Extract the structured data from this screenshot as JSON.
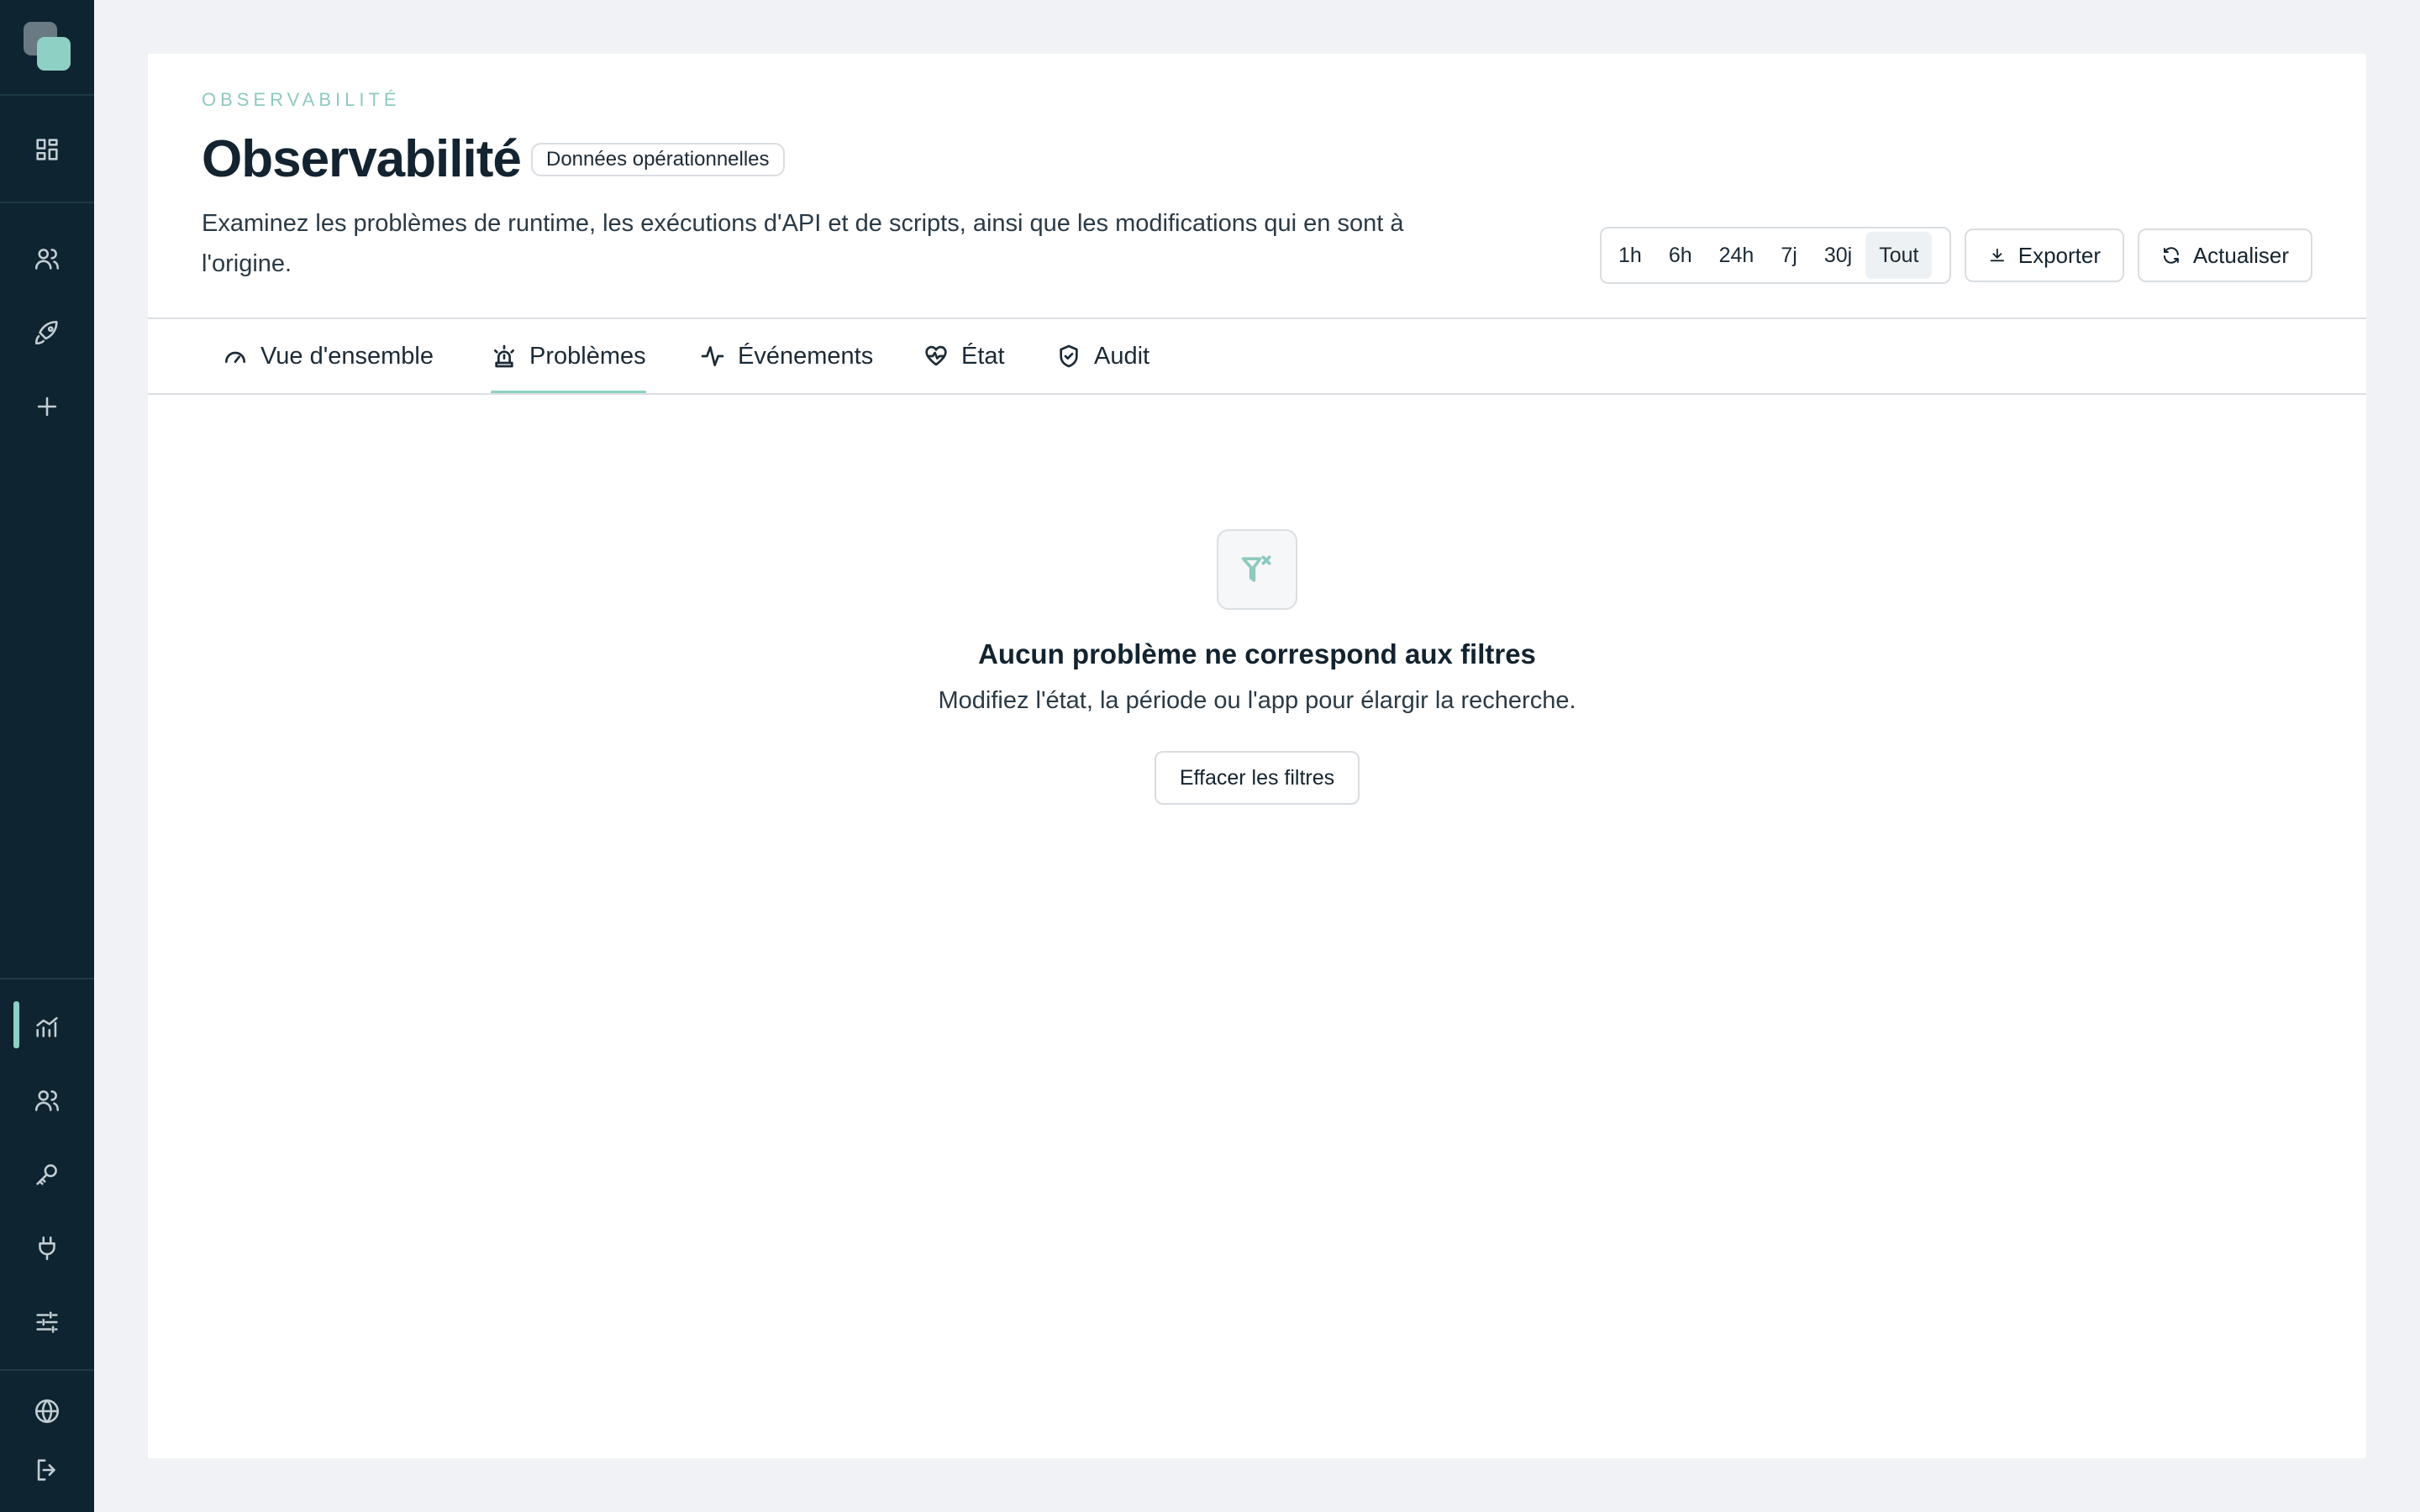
{
  "header": {
    "eyebrow": "OBSERVABILITÉ",
    "title": "Observabilité",
    "badge": "Données opérationnelles",
    "description": "Examinez les problèmes de runtime, les exécutions d'API et de scripts, ainsi que les modifications qui en sont à l'origine."
  },
  "time_range": {
    "options": [
      "1h",
      "6h",
      "24h",
      "7j",
      "30j",
      "Tout"
    ],
    "selected": "Tout"
  },
  "actions": {
    "export_label": "Exporter",
    "refresh_label": "Actualiser"
  },
  "tabs": [
    {
      "label": "Vue d'ensemble",
      "icon": "gauge-icon"
    },
    {
      "label": "Problèmes",
      "icon": "siren-icon"
    },
    {
      "label": "Événements",
      "icon": "activity-icon"
    },
    {
      "label": "État",
      "icon": "heart-pulse-icon"
    },
    {
      "label": "Audit",
      "icon": "shield-check-icon"
    }
  ],
  "active_tab": "Problèmes",
  "empty_state": {
    "icon": "filter-x-icon",
    "title": "Aucun problème ne correspond aux filtres",
    "subtitle": "Modifiez l'état, la période ou l'app pour élargir la recherche.",
    "button_label": "Effacer les filtres"
  },
  "sidebar": {
    "top_icons": [
      "dashboard-icon",
      "users-icon",
      "rocket-icon",
      "plus-icon"
    ],
    "bottom_icons": [
      "analytics-icon",
      "users-icon",
      "key-icon",
      "plug-icon",
      "sliders-icon",
      "globe-icon",
      "logout-icon"
    ],
    "active": "analytics-icon"
  },
  "colors": {
    "sidebar": "#0e2431",
    "accent": "#8ed0c3",
    "background": "#f1f2f5"
  }
}
